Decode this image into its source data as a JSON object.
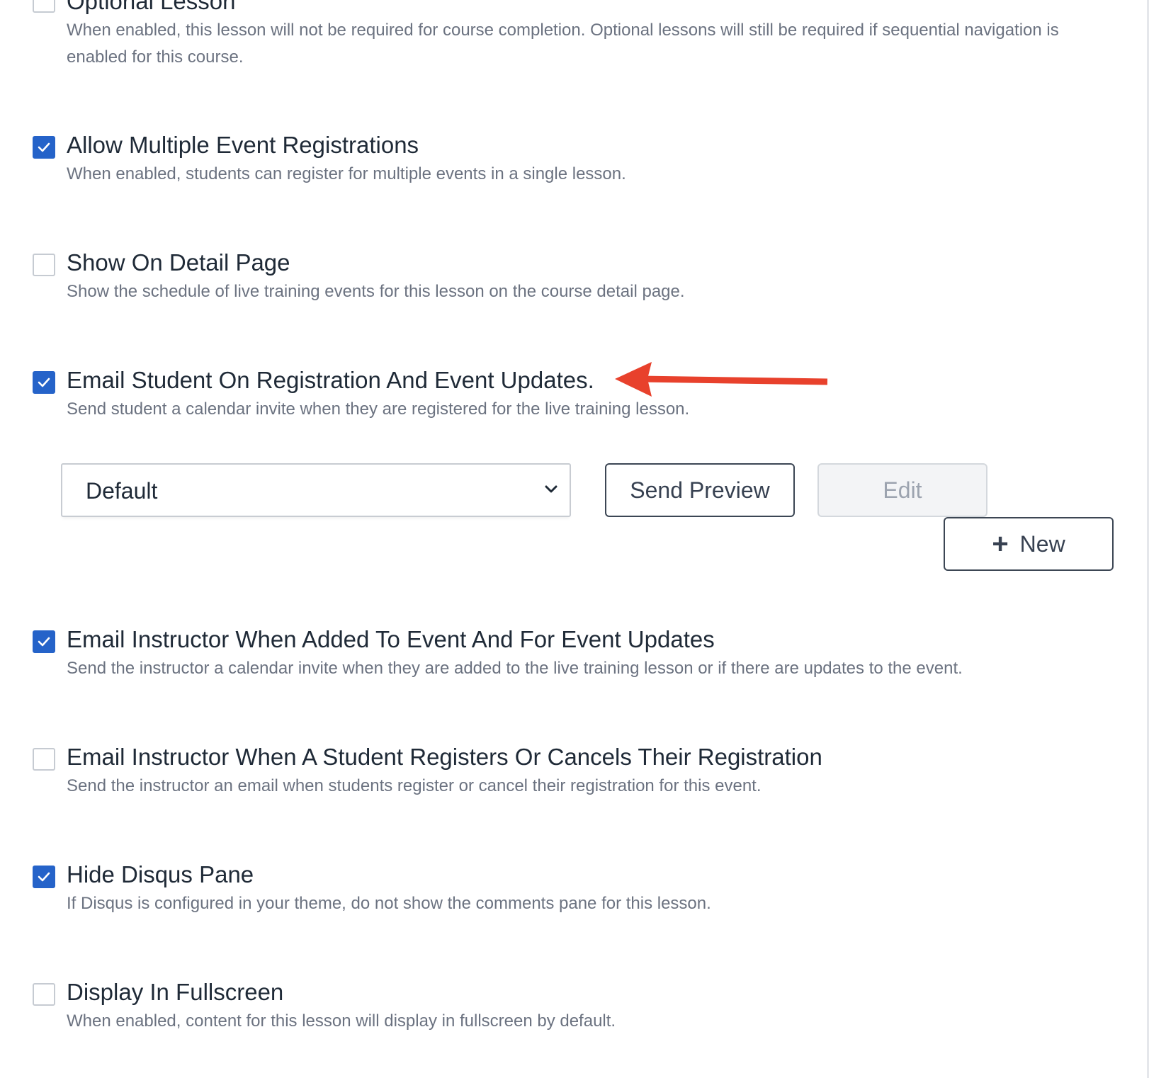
{
  "settings": [
    {
      "label": "Optional Lesson",
      "description": "When enabled, this lesson will not be required for course completion. Optional lessons will still be required if sequential navigation is enabled for this course.",
      "checked": false
    },
    {
      "label": "Allow Multiple Event Registrations",
      "description": "When enabled, students can register for multiple events in a single lesson.",
      "checked": true
    },
    {
      "label": "Show On Detail Page",
      "description": "Show the schedule of live training events for this lesson on the course detail page.",
      "checked": false
    },
    {
      "label": "Email Student On Registration And Event Updates.",
      "description": "Send student a calendar invite when they are registered for the live training lesson.",
      "checked": true
    },
    {
      "label": "Email Instructor When Added To Event And For Event Updates",
      "description": "Send the instructor a calendar invite when they are added to the live training lesson or if there are updates to the event.",
      "checked": true
    },
    {
      "label": "Email Instructor When A Student Registers Or Cancels Their Registration",
      "description": "Send the instructor an email when students register or cancel their registration for this event.",
      "checked": false
    },
    {
      "label": "Hide Disqus Pane",
      "description": "If Disqus is configured in your theme, do not show the comments pane for this lesson.",
      "checked": true
    },
    {
      "label": "Display In Fullscreen",
      "description": "When enabled, content for this lesson will display in fullscreen by default.",
      "checked": false
    }
  ],
  "email_template": {
    "selected": "Default",
    "send_preview_label": "Send Preview",
    "edit_label": "Edit",
    "new_label": "New"
  },
  "colors": {
    "accent": "#2563c9",
    "annotation_arrow": "#e8412c",
    "label_text": "#1f2a37",
    "description_text": "#6b7280"
  }
}
